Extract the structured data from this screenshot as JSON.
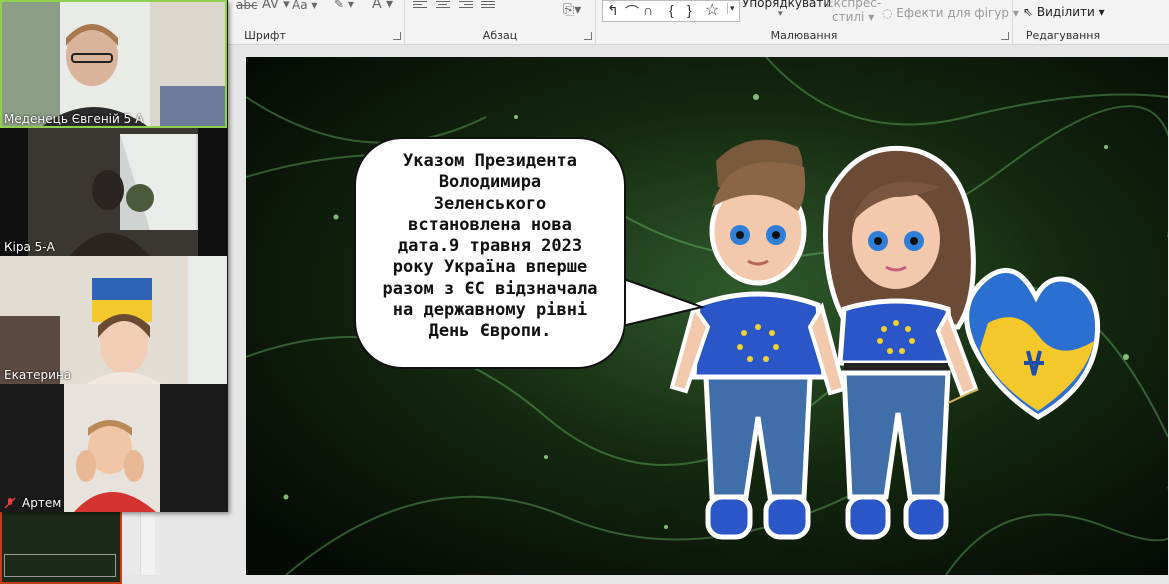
{
  "ribbon": {
    "groups": {
      "font": "Шрифт",
      "paragraph": "Абзац",
      "drawing": "Малювання",
      "editing": "Редагування"
    },
    "font_aa": "Aa",
    "arrange": "Упорядкувати",
    "quick_styles_line1": "Експрес-",
    "quick_styles_line2": "стилі",
    "shape_effects": "Ефекти для фігур",
    "select": "Виділити"
  },
  "participants": [
    {
      "name": "Меденець Євгеній 5 А",
      "active": true
    },
    {
      "name": "Кіра 5-А",
      "active": false
    },
    {
      "name": "Екатерина",
      "active": false
    },
    {
      "name": "Артем",
      "active": false,
      "muted": true
    }
  ],
  "slide": {
    "bubble_lines": [
      "Указом Президента",
      "Володимира",
      "Зеленського",
      "встановлена нова",
      "дата.9 травня 2023",
      "року Україна вперше",
      "разом з ЄС відзначала",
      "на державному рівні",
      "День Європи."
    ]
  },
  "colors": {
    "accent_thumb": "#c43e1c",
    "active_speaker": "#8fd14f",
    "slide_glow": "#7fe07f"
  }
}
